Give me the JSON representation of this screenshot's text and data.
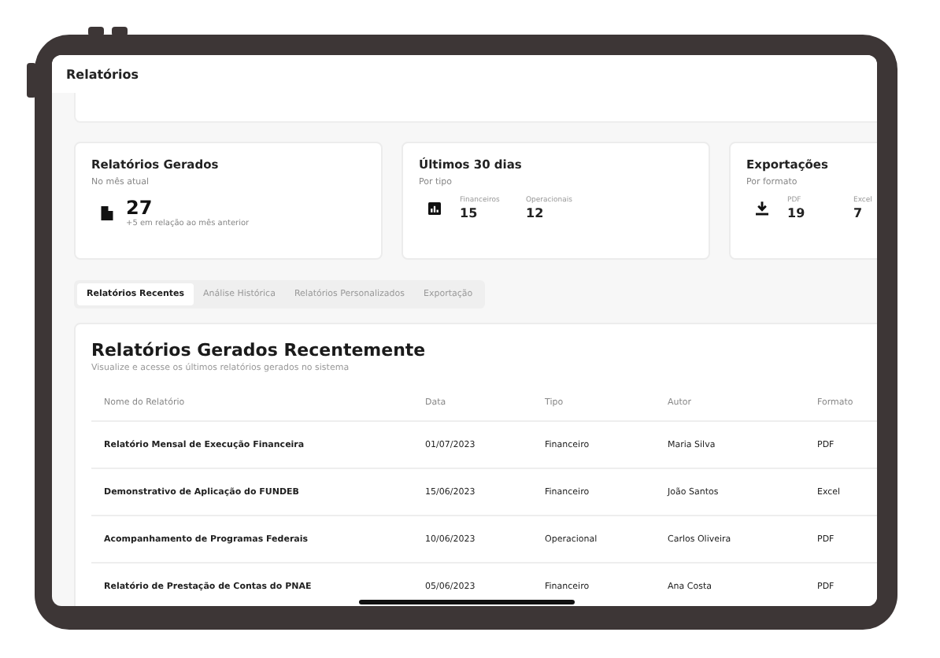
{
  "window": {
    "title": "Relatórios"
  },
  "stat_cards": [
    {
      "kind": "single",
      "title": "Relatórios Gerados",
      "subtitle": "No mês atual",
      "value": "27",
      "note": "+5 em relação ao mês anterior"
    },
    {
      "kind": "split",
      "title": "Últimos 30 dias",
      "subtitle": "Por tipo",
      "metrics": [
        {
          "label": "Financeiros",
          "value": "15"
        },
        {
          "label": "Operacionais",
          "value": "12"
        }
      ]
    },
    {
      "kind": "split",
      "title": "Exportações",
      "subtitle": "Por formato",
      "metrics": [
        {
          "label": "PDF",
          "value": "19"
        },
        {
          "label": "Excel",
          "value": "7"
        }
      ]
    }
  ],
  "tabs": [
    {
      "label": "Relatórios Recentes",
      "selected": true
    },
    {
      "label": "Análise Histórica",
      "selected": false
    },
    {
      "label": "Relatórios Personalizados",
      "selected": false
    },
    {
      "label": "Exportação",
      "selected": false
    }
  ],
  "table": {
    "title": "Relatórios Gerados Recentemente",
    "subtitle": "Visualize e acesse os últimos relatórios gerados no sistema",
    "columns": [
      "Nome do Relatório",
      "Data",
      "Tipo",
      "Autor",
      "Formato"
    ],
    "rows": [
      [
        "Relatório Mensal de Execução Financeira",
        "01/07/2023",
        "Financeiro",
        "Maria Silva",
        "PDF"
      ],
      [
        "Demonstrativo de Aplicação do FUNDEB",
        "15/06/2023",
        "Financeiro",
        "João Santos",
        "Excel"
      ],
      [
        "Acompanhamento de Programas Federais",
        "10/06/2023",
        "Operacional",
        "Carlos Oliveira",
        "PDF"
      ],
      [
        "Relatório de Prestação de Contas do PNAE",
        "05/06/2023",
        "Financeiro",
        "Ana Costa",
        "PDF"
      ]
    ]
  }
}
